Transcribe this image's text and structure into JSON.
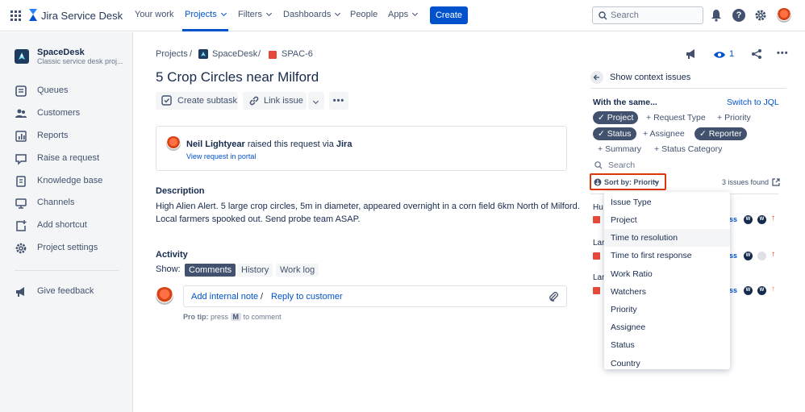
{
  "nav": {
    "product": "Jira Service Desk",
    "links": {
      "your_work": "Your work",
      "projects": "Projects",
      "filters": "Filters",
      "dashboards": "Dashboards",
      "people": "People",
      "apps": "Apps"
    },
    "create_label": "Create",
    "search_placeholder": "Search"
  },
  "sidebar": {
    "project_name": "SpaceDesk",
    "project_type": "Classic service desk proj...",
    "items": [
      {
        "label": "Queues",
        "icon": "queues-icon"
      },
      {
        "label": "Customers",
        "icon": "customers-icon"
      },
      {
        "label": "Reports",
        "icon": "reports-icon"
      },
      {
        "label": "Raise a request",
        "icon": "raise-request-icon"
      },
      {
        "label": "Knowledge base",
        "icon": "knowledge-base-icon"
      },
      {
        "label": "Channels",
        "icon": "channels-icon"
      },
      {
        "label": "Add shortcut",
        "icon": "add-shortcut-icon"
      },
      {
        "label": "Project settings",
        "icon": "gear-icon"
      }
    ],
    "feedback_label": "Give feedback"
  },
  "breadcrumb": {
    "projects": "Projects",
    "project": "SpaceDesk",
    "issue_key": "SPAC-6",
    "sep": "/"
  },
  "issue": {
    "title": "5 Crop Circles near Milford",
    "create_subtask": "Create subtask",
    "link_issue": "Link issue",
    "reporter": "Neil Lightyear",
    "raised_text": "raised this request via",
    "channel": "Jira",
    "view_portal": "View request in portal",
    "description_heading": "Description",
    "description_line1": "High Alien Alert. 5 large crop circles, 5m in diameter, appeared overnight in a corn field 6km North of Milford.",
    "description_line2": "Local farmers spooked out. Send probe team ASAP."
  },
  "activity": {
    "heading": "Activity",
    "show_label": "Show:",
    "tabs": [
      "Comments",
      "History",
      "Work log"
    ],
    "selected_tab": "Comments",
    "add_internal_note": "Add internal note",
    "slash": "/",
    "reply_to_customer": "Reply to customer",
    "pro_tip_label": "Pro tip:",
    "pro_tip_press": "press",
    "pro_tip_key": "M",
    "pro_tip_rest": "to comment"
  },
  "watch_count": "1",
  "context": {
    "show_context": "Show context issues",
    "with_same": "With the same...",
    "switch_jql": "Switch to JQL",
    "chips": [
      {
        "label": "Project",
        "selected": true
      },
      {
        "label": "Request Type",
        "selected": false
      },
      {
        "label": "Priority",
        "selected": false
      },
      {
        "label": "Status",
        "selected": true
      },
      {
        "label": "Assignee",
        "selected": false
      },
      {
        "label": "Reporter",
        "selected": true
      },
      {
        "label": "Summary",
        "selected": false
      },
      {
        "label": "Status Category",
        "selected": false
      }
    ],
    "search_placeholder": "Search",
    "sort_by": "Sort by: Priority",
    "issues_found": "3 issues found",
    "results": [
      {
        "title_fragment": "Hu",
        "status_fragment": "ss",
        "avatars": [
          "W",
          "W"
        ],
        "priority_color": "#de350b"
      },
      {
        "title_fragment": "Lar",
        "status_fragment": "ss",
        "avatars": [
          "W",
          ""
        ],
        "priority_color": "#de350b"
      },
      {
        "title_fragment": "Lar",
        "status_fragment": "ss",
        "avatars": [
          "W",
          "W"
        ],
        "priority_color": "#ff7452"
      }
    ],
    "sort_options": [
      "Issue Type",
      "Project",
      "Time to resolution",
      "Time to first response",
      "Work Ratio",
      "Watchers",
      "Priority",
      "Assignee",
      "Status",
      "Country"
    ],
    "hovered_option": "Time to resolution"
  },
  "colors": {
    "brand": "#0052cc",
    "highlight_border": "#de350b",
    "selected_chip": "#42526e"
  }
}
